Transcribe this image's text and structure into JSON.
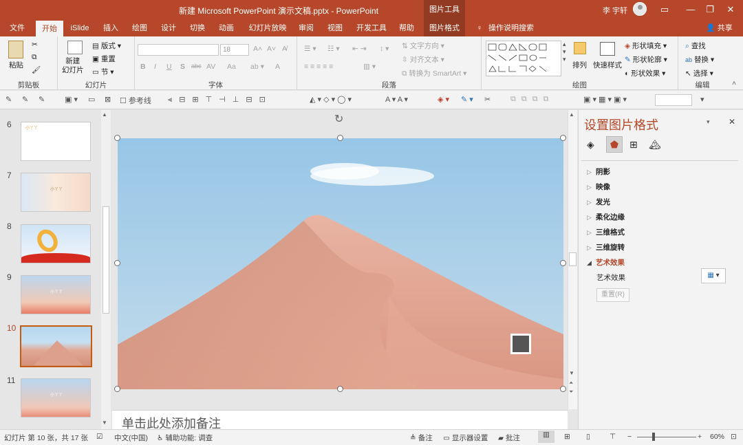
{
  "window": {
    "title": "新建 Microsoft PowerPoint 演示文稿.pptx  -  PowerPoint",
    "context_tools": "图片工具",
    "user": "李 宇轩"
  },
  "tabs": [
    "文件",
    "开始",
    "iSlide",
    "插入",
    "绘图",
    "设计",
    "切换",
    "动画",
    "幻灯片放映",
    "审阅",
    "视图",
    "开发工具",
    "帮助",
    "图片格式"
  ],
  "tellme": "操作说明搜索",
  "share": "共享",
  "ribbon": {
    "clipboard": {
      "paste": "粘贴",
      "label": "剪贴板"
    },
    "slides": {
      "new_slide": "新建\n幻灯片",
      "layout": "版式",
      "reset": "重置",
      "section": "节",
      "label": "幻灯片"
    },
    "font": {
      "size": "18",
      "label": "字体",
      "buttons": [
        "B",
        "I",
        "U",
        "S",
        "abc",
        "AV",
        "Aa",
        "A"
      ]
    },
    "paragraph": {
      "text_direction": "文字方向",
      "align_text": "对齐文本",
      "smartart": "转换为 SmartArt",
      "label": "段落"
    },
    "drawing": {
      "arrange": "排列",
      "quick_styles": "快速样式",
      "fill": "形状填充",
      "outline": "形状轮廓",
      "effects": "形状效果",
      "label": "绘图"
    },
    "editing": {
      "find": "查找",
      "replace": "替换",
      "select": "选择",
      "label": "编辑"
    }
  },
  "toolbar2": {
    "guides": "参考线"
  },
  "slides": [
    {
      "num": "6",
      "text": "小丫丫"
    },
    {
      "num": "7",
      "text": "小丫丫"
    },
    {
      "num": "8",
      "text": ""
    },
    {
      "num": "9",
      "text": "小丫丫"
    },
    {
      "num": "10",
      "text": ""
    },
    {
      "num": "11",
      "text": "小丫丫"
    }
  ],
  "notes_placeholder": "单击此处添加备注",
  "pane": {
    "title": "设置图片格式",
    "sections": [
      "阴影",
      "映像",
      "发光",
      "柔化边缘",
      "三维格式",
      "三维旋转",
      "艺术效果"
    ],
    "expanded": "艺术效果",
    "art_label": "艺术效果",
    "reset": "重置(R)"
  },
  "status": {
    "slide_info": "幻灯片 第 10 张，共 17 张",
    "lang": "中文(中国)",
    "accessibility": "辅助功能: 调查",
    "notes": "备注",
    "display": "显示器设置",
    "comments": "批注",
    "zoom": "60%"
  },
  "colors": {
    "accent": "#b7472a",
    "dark_accent": "#933a22"
  }
}
